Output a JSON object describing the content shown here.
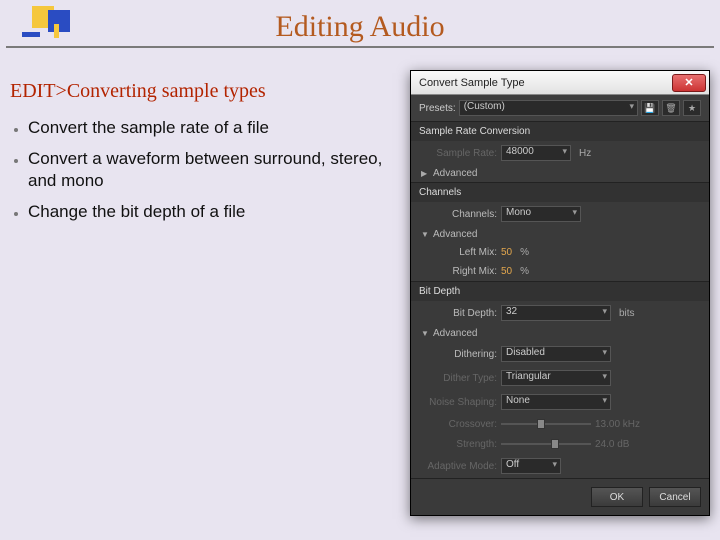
{
  "slide": {
    "title": "Editing Audio",
    "subhead": "EDIT>Converting sample types",
    "bullets": [
      "Convert the sample rate of a file",
      "Convert a waveform between surround, stereo, and mono",
      "Change the bit depth of a file"
    ]
  },
  "dialog": {
    "title": "Convert Sample Type",
    "presets_label": "Presets:",
    "presets_value": "(Custom)",
    "sections": {
      "sample_rate_conversion": {
        "heading": "Sample Rate Conversion",
        "sample_rate_label": "Sample Rate:",
        "sample_rate_value": "48000",
        "sample_rate_unit": "Hz",
        "advanced_label": "Advanced"
      },
      "channels": {
        "heading": "Channels",
        "channels_label": "Channels:",
        "channels_value": "Mono",
        "advanced_label": "Advanced",
        "left_mix_label": "Left Mix:",
        "left_mix_value": "50",
        "left_mix_unit": "%",
        "right_mix_label": "Right Mix:",
        "right_mix_value": "50",
        "right_mix_unit": "%"
      },
      "bit_depth": {
        "heading": "Bit Depth",
        "bit_depth_label": "Bit Depth:",
        "bit_depth_value": "32",
        "bit_depth_unit": "bits",
        "advanced_label": "Advanced",
        "dithering_label": "Dithering:",
        "dithering_value": "Disabled",
        "dither_type_label": "Dither Type:",
        "dither_type_value": "Triangular",
        "noise_shaping_label": "Noise Shaping:",
        "noise_shaping_value": "None",
        "crossover_label": "Crossover:",
        "crossover_value": "13.00 kHz",
        "strength_label": "Strength:",
        "strength_value": "24.0 dB",
        "adaptive_mode_label": "Adaptive Mode:",
        "adaptive_mode_value": "Off"
      }
    },
    "buttons": {
      "ok": "OK",
      "cancel": "Cancel"
    }
  }
}
